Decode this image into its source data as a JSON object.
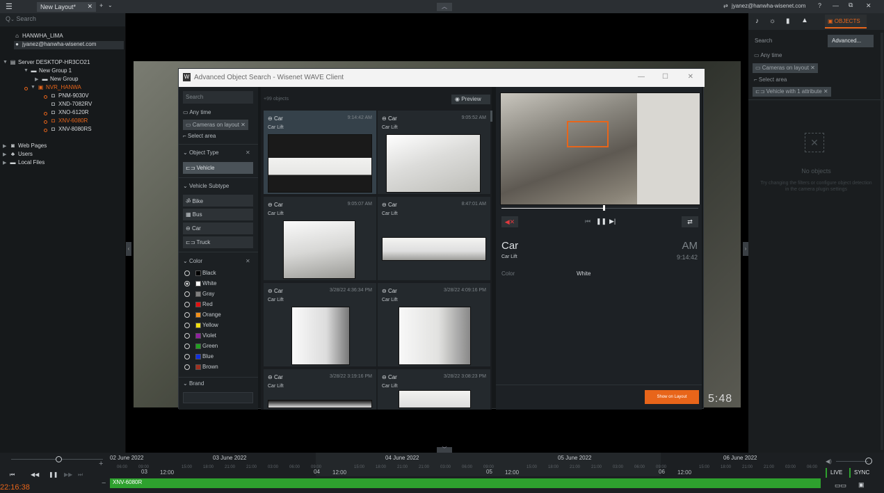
{
  "topbar": {
    "tab_label": "New Layout*",
    "user": "jyanez@hanwha-wisenet.com"
  },
  "left": {
    "search_placeholder": "Search",
    "system": "HANWHA_LIMA",
    "user": "jyanez@hanwha-wisenet.com",
    "server": "Server DESKTOP-HR3CO21",
    "group1": "New Group 1",
    "group2": "New Group",
    "nvr": "NVR_HANWA",
    "cameras": [
      "PNM-9030V",
      "XND-7082RV",
      "XNO-6120R",
      "XNV-6080R",
      "XNV-8080RS"
    ],
    "web_pages": "Web Pages",
    "users": "Users",
    "local_files": "Local Files"
  },
  "center": {
    "clock": "5:48"
  },
  "dialog": {
    "title": "Advanced Object Search - Wisenet WAVE Client",
    "search_placeholder": "Search",
    "any_time": "Any time",
    "cameras_chip": "Cameras on layout",
    "select_area": "Select area",
    "object_type": "Object Type",
    "vehicle": "Vehicle",
    "vehicle_subtype": "Vehicle Subtype",
    "subtypes": [
      "Bike",
      "Bus",
      "Car",
      "Truck"
    ],
    "color_label": "Color",
    "colors": [
      {
        "name": "Black",
        "hex": "#000000"
      },
      {
        "name": "White",
        "hex": "#ffffff"
      },
      {
        "name": "Gray",
        "hex": "#808080"
      },
      {
        "name": "Red",
        "hex": "#e01010"
      },
      {
        "name": "Orange",
        "hex": "#f0901a"
      },
      {
        "name": "Yellow",
        "hex": "#f0e010"
      },
      {
        "name": "Violet",
        "hex": "#9020a0"
      },
      {
        "name": "Green",
        "hex": "#20a020"
      },
      {
        "name": "Blue",
        "hex": "#1030e0"
      },
      {
        "name": "Brown",
        "hex": "#a03020"
      }
    ],
    "selected_color": "White",
    "brand": "Brand",
    "objects_count": "+99 objects",
    "preview_btn": "Preview",
    "results": [
      {
        "cat": "Car",
        "time": "9:14:42 AM",
        "sub": "Car Lift"
      },
      {
        "cat": "Car",
        "time": "9:05:52 AM",
        "sub": "Car Lift"
      },
      {
        "cat": "Car",
        "time": "9:05:07 AM",
        "sub": "Car Lift"
      },
      {
        "cat": "Car",
        "time": "8:47:01 AM",
        "sub": "Car Lift"
      },
      {
        "cat": "Car",
        "time": "3/28/22 4:36:34 PM",
        "sub": "Car Lift"
      },
      {
        "cat": "Car",
        "time": "3/28/22 4:09:16 PM",
        "sub": "Car Lift"
      },
      {
        "cat": "Car",
        "time": "3/28/22 3:19:16 PM",
        "sub": "Car Lift"
      },
      {
        "cat": "Car",
        "time": "3/28/22 3:08:23 PM",
        "sub": "Car Lift"
      }
    ],
    "preview": {
      "title": "Car",
      "ampm": "AM",
      "camera": "Car Lift",
      "time": "9:14:42",
      "attr_key": "Color",
      "attr_value": "White",
      "show_btn": "Show on Layout",
      "progress": 0.52
    }
  },
  "right": {
    "search_placeholder": "Search",
    "advanced": "Advanced...",
    "objects_tab": "OBJECTS",
    "any_time": "Any time",
    "cameras_chip": "Cameras on layout",
    "select_area": "Select area",
    "vehicle_chip": "Vehicle with 1 attribute",
    "no_objects": "No objects",
    "hint": "Try changing the filters or configure object detection in the camera plugin settings"
  },
  "timeline": {
    "dates": [
      {
        "label": "02 June 2022",
        "day": "03"
      },
      {
        "label": "03 June 2022",
        "day": ""
      },
      {
        "label": "04 June 2022",
        "day": "04"
      },
      {
        "label": "05 June 2022",
        "day": "05"
      },
      {
        "label": "06 June 2022",
        "day": "06"
      }
    ],
    "hours": [
      "21:00",
      "03:00",
      "06:00",
      "09:00",
      "12:00",
      "15:00",
      "18:00",
      "21:00"
    ],
    "camera": "XNV-6080R",
    "current_time": "22:16:38",
    "live": "LIVE",
    "sync": "SYNC"
  }
}
